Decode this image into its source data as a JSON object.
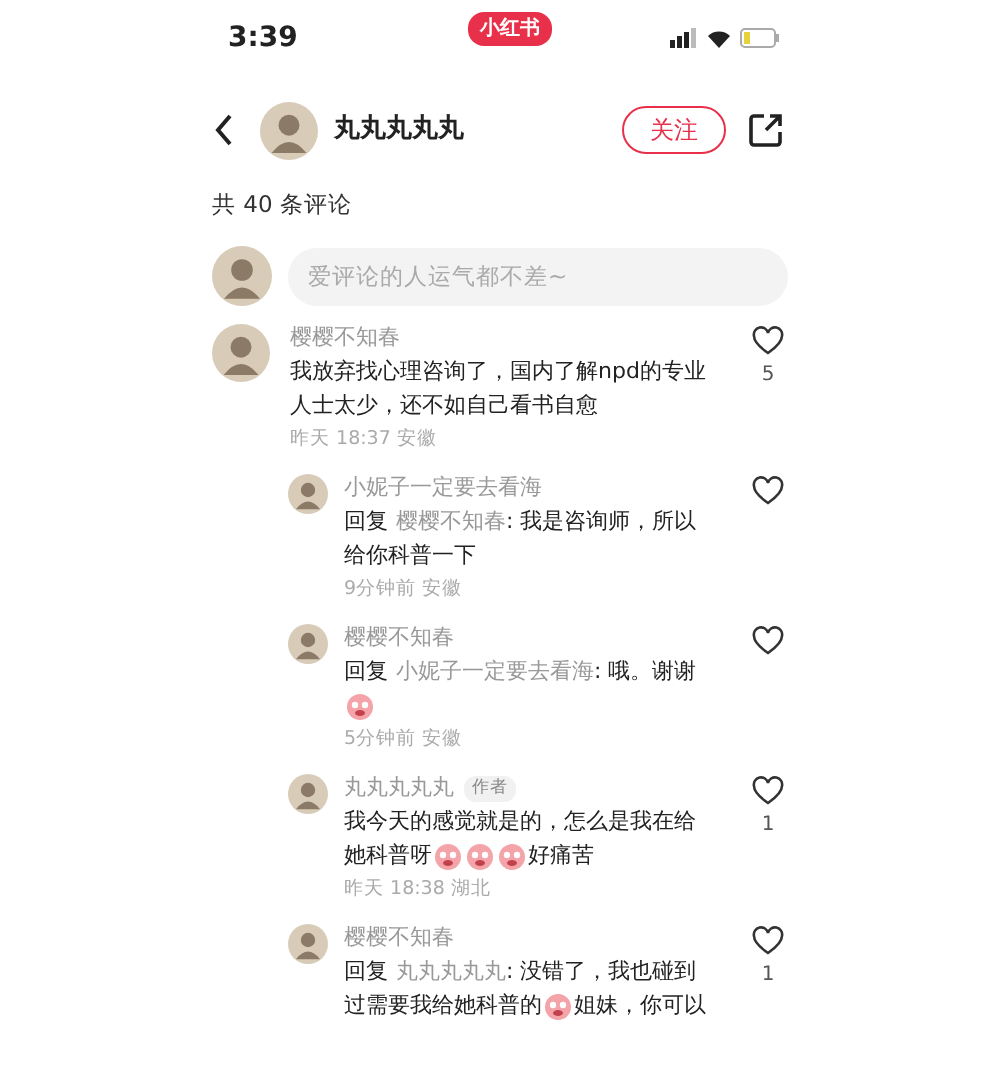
{
  "status_bar": {
    "time": "3:39",
    "app_badge": "小红书"
  },
  "header": {
    "author_name": "丸丸丸丸丸",
    "follow_button": "关注"
  },
  "comment_count": "共 40 条评论",
  "comment_input": {
    "placeholder": "爱评论的人运气都不差~"
  },
  "comments": [
    {
      "kind": "comment",
      "name": "樱樱不知春",
      "lines": [
        [
          {
            "kind": "text",
            "text": "我放弃找心理咨询了，国内了解npd的专业"
          }
        ],
        [
          {
            "kind": "text",
            "text": "人士太少，还不如自己看书自愈"
          }
        ]
      ],
      "meta": "昨天 18:37 安徽",
      "likes": "5"
    },
    {
      "kind": "reply",
      "name": "小妮子一定要去看海",
      "lines": [
        [
          {
            "kind": "label",
            "text": "回复"
          },
          {
            "kind": "mention",
            "text": "樱樱不知春"
          },
          {
            "kind": "text",
            "text": ": 我是咨询师，所以"
          }
        ],
        [
          {
            "kind": "text",
            "text": "给你科普一下"
          }
        ]
      ],
      "meta": "9分钟前 安徽"
    },
    {
      "kind": "reply",
      "name": "樱樱不知春",
      "lines": [
        [
          {
            "kind": "label",
            "text": "回复"
          },
          {
            "kind": "mention",
            "text": "小妮子一定要去看海"
          },
          {
            "kind": "text",
            "text": ": 哦。谢谢"
          }
        ],
        [
          {
            "kind": "emoji"
          }
        ]
      ],
      "meta": "5分钟前 安徽"
    },
    {
      "kind": "reply",
      "name": "丸丸丸丸丸",
      "author_tag": "作者",
      "lines": [
        [
          {
            "kind": "text",
            "text": "我今天的感觉就是的，怎么是我在给"
          }
        ],
        [
          {
            "kind": "text",
            "text": "她科普呀"
          },
          {
            "kind": "emoji"
          },
          {
            "kind": "emoji"
          },
          {
            "kind": "emoji"
          },
          {
            "kind": "text",
            "text": "好痛苦"
          }
        ]
      ],
      "meta": "昨天 18:38 湖北",
      "likes": "1"
    },
    {
      "kind": "reply",
      "name": "樱樱不知春",
      "lines": [
        [
          {
            "kind": "label",
            "text": "回复"
          },
          {
            "kind": "mention",
            "text": "丸丸丸丸丸"
          },
          {
            "kind": "text",
            "text": ": 没错了，我也碰到"
          }
        ],
        [
          {
            "kind": "text",
            "text": "过需要我给她科普的"
          },
          {
            "kind": "emoji"
          },
          {
            "kind": "text",
            "text": "姐妹，你可以"
          }
        ]
      ],
      "likes": "1"
    }
  ]
}
